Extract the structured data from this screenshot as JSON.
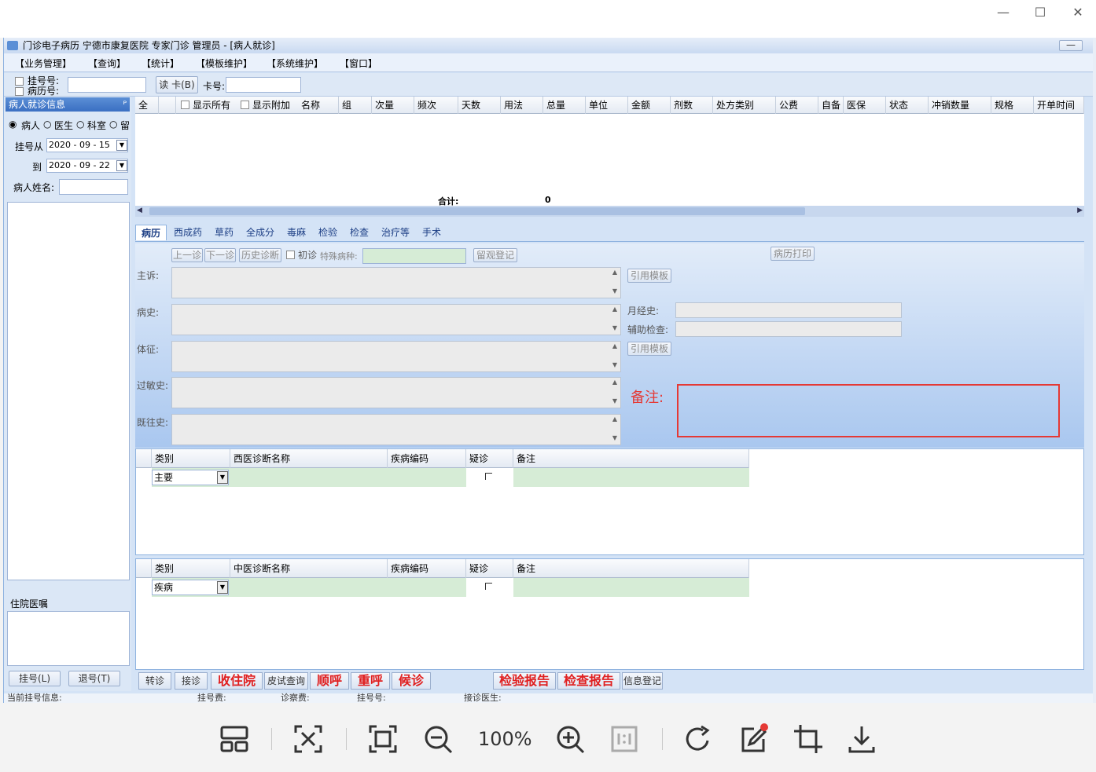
{
  "window": {
    "title": "门诊电子病历  宁德市康复医院  专家门诊  管理员 - [病人就诊]",
    "min_glyph": "—",
    "max_glyph": "☐",
    "close_glyph": "✕"
  },
  "menu": [
    "【业务管理】",
    "【查询】",
    "【统计】",
    "【模板维护】",
    "【系统维护】",
    "【窗口】"
  ],
  "toolbar": {
    "reg_no_label": "挂号号:",
    "record_no_label": "病历号:",
    "read_card_button": "读 卡(B)",
    "card_no_label": "卡号:"
  },
  "left_panel": {
    "title": "病人就诊信息",
    "pin": "ᴾ",
    "radio_patient": "病人",
    "radio_doctor": "医生",
    "radio_dept": "科室",
    "radio_stay": "留",
    "date_from_label": "挂号从",
    "date_from": "2020 - 09 - 15",
    "date_to_label": "到",
    "date_to": "2020 - 09 - 22",
    "patient_name_label": "病人姓名:",
    "inpatient_orders": "住院医嘱",
    "register_button": "挂号(L)",
    "unregister_button": "退号(T)"
  },
  "prescription_grid": {
    "all_label": "全",
    "show_all": "显示所有",
    "show_extra": "显示附加",
    "columns": [
      "名称",
      "组",
      "次量",
      "频次",
      "天数",
      "用法",
      "总量",
      "单位",
      "金额",
      "剂数",
      "处方类别",
      "公费",
      "自备",
      "医保",
      "状态",
      "冲销数量",
      "规格",
      "开单时间"
    ],
    "total_label": "合计:",
    "total_value": "0"
  },
  "tabs": [
    "病历",
    "西成药",
    "草药",
    "全成分",
    "毒麻",
    "检验",
    "检查",
    "治疗等",
    "手术"
  ],
  "record": {
    "prev_visit": "上一诊",
    "next_visit": "下一诊",
    "history_diag": "历史诊断",
    "first_visit": "初诊",
    "special_disease_label": "特殊病种:",
    "observation_register": "留观登记",
    "print_record": "病历打印",
    "chief_complaint": "主诉:",
    "history": "病史:",
    "physical_exam": "体征:",
    "allergy_history": "过敏史:",
    "past_history": "既往史:",
    "use_template_1": "引用模板",
    "use_template_2": "引用模板",
    "menstrual_history": "月经史:",
    "aux_exam": "辅助检查:",
    "remark_label": "备注:"
  },
  "western_diag": {
    "columns": [
      "类别",
      "西医诊断名称",
      "疾病编码",
      "疑诊",
      "备注"
    ],
    "row_type": "主要"
  },
  "chinese_diag": {
    "columns": [
      "类别",
      "中医诊断名称",
      "疾病编码",
      "疑诊",
      "备注"
    ],
    "row_type": "疾病"
  },
  "bottom_buttons": {
    "transfer": "转诊",
    "receive": "接诊",
    "admit": "收住院",
    "skin_test": "皮试查询",
    "call_next": "顺呼",
    "recall": "重呼",
    "wait": "候诊",
    "lab_report": "检验报告",
    "exam_report": "检查报告",
    "info_register": "信息登记"
  },
  "status_bar": {
    "current_reg": "当前挂号信息:",
    "reg_fee": "挂号费:",
    "consult_fee": "诊察费:",
    "reg_no": "挂号号:",
    "doctor": "接诊医生:"
  },
  "viewer": {
    "zoom": "100%",
    "accent": "#e53935"
  }
}
